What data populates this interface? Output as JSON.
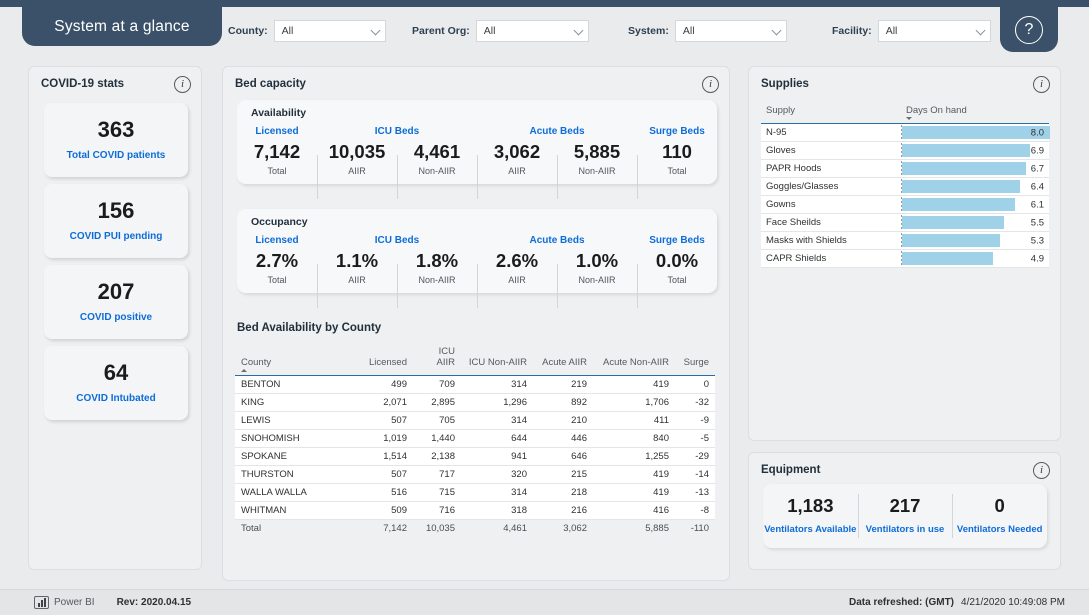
{
  "header": {
    "title": "System at a glance",
    "help_icon": "question-mark-icon",
    "filters": [
      {
        "label": "County:",
        "value": "All"
      },
      {
        "label": "Parent Org:",
        "value": "All"
      },
      {
        "label": "System:",
        "value": "All"
      },
      {
        "label": "Facility:",
        "value": "All"
      }
    ]
  },
  "covid": {
    "title": "COVID-19 stats",
    "cards": [
      {
        "value": "363",
        "label": "Total COVID patients"
      },
      {
        "value": "156",
        "label": "COVID PUI pending"
      },
      {
        "value": "207",
        "label": "COVID positive"
      },
      {
        "value": "64",
        "label": "COVID Intubated"
      }
    ]
  },
  "bed": {
    "title": "Bed capacity",
    "availability": {
      "title": "Availability",
      "groups": [
        {
          "label": "Licensed",
          "span": 1
        },
        {
          "label": "ICU Beds",
          "span": 2
        },
        {
          "label": "Acute Beds",
          "span": 2
        },
        {
          "label": "Surge Beds",
          "span": 1
        }
      ],
      "metrics": [
        {
          "value": "7,142",
          "sub": "Total"
        },
        {
          "value": "10,035",
          "sub": "AIIR"
        },
        {
          "value": "4,461",
          "sub": "Non-AIIR"
        },
        {
          "value": "3,062",
          "sub": "AIIR"
        },
        {
          "value": "5,885",
          "sub": "Non-AIIR"
        },
        {
          "value": "110",
          "sub": "Total"
        }
      ]
    },
    "occupancy": {
      "title": "Occupancy",
      "groups": [
        {
          "label": "Licensed",
          "span": 1
        },
        {
          "label": "ICU Beds",
          "span": 2
        },
        {
          "label": "Acute Beds",
          "span": 2
        },
        {
          "label": "Surge Beds",
          "span": 1
        }
      ],
      "metrics": [
        {
          "value": "2.7%",
          "sub": "Total"
        },
        {
          "value": "1.1%",
          "sub": "AIIR"
        },
        {
          "value": "1.8%",
          "sub": "Non-AIIR"
        },
        {
          "value": "2.6%",
          "sub": "AIIR"
        },
        {
          "value": "1.0%",
          "sub": "Non-AIIR"
        },
        {
          "value": "0.0%",
          "sub": "Total"
        }
      ]
    },
    "table": {
      "title": "Bed Availability by County",
      "columns": [
        "County",
        "Licensed",
        "ICU AIIR",
        "ICU Non-AIIR",
        "Acute AIIR",
        "Acute Non-AIIR",
        "Surge"
      ],
      "sort_column": "County",
      "sort_direction": "asc",
      "rows": [
        [
          "BENTON",
          "499",
          "709",
          "314",
          "219",
          "419",
          "0"
        ],
        [
          "KING",
          "2,071",
          "2,895",
          "1,296",
          "892",
          "1,706",
          "-32"
        ],
        [
          "LEWIS",
          "507",
          "705",
          "314",
          "210",
          "411",
          "-9"
        ],
        [
          "SNOHOMISH",
          "1,019",
          "1,440",
          "644",
          "446",
          "840",
          "-5"
        ],
        [
          "SPOKANE",
          "1,514",
          "2,138",
          "941",
          "646",
          "1,255",
          "-29"
        ],
        [
          "THURSTON",
          "507",
          "717",
          "320",
          "215",
          "419",
          "-14"
        ],
        [
          "WALLA WALLA",
          "516",
          "715",
          "314",
          "218",
          "419",
          "-13"
        ],
        [
          "WHITMAN",
          "509",
          "716",
          "318",
          "216",
          "416",
          "-8"
        ]
      ],
      "total_row": [
        "Total",
        "7,142",
        "10,035",
        "4,461",
        "3,062",
        "5,885",
        "-110"
      ]
    }
  },
  "supplies": {
    "title": "Supplies",
    "columns": [
      "Supply",
      "Days On hand"
    ],
    "sort_column": "Days On hand",
    "sort_direction": "desc",
    "bar_color": "#9fd2e8",
    "max_value": 8.0,
    "rows": [
      {
        "name": "N-95",
        "value": "8.0",
        "num": 8.0
      },
      {
        "name": "Gloves",
        "value": "6.9",
        "num": 6.9
      },
      {
        "name": "PAPR Hoods",
        "value": "6.7",
        "num": 6.7
      },
      {
        "name": "Goggles/Glasses",
        "value": "6.4",
        "num": 6.4
      },
      {
        "name": "Gowns",
        "value": "6.1",
        "num": 6.1
      },
      {
        "name": "Face Sheilds",
        "value": "5.5",
        "num": 5.5
      },
      {
        "name": "Masks with Shields",
        "value": "5.3",
        "num": 5.3
      },
      {
        "name": "CAPR Shields",
        "value": "4.9",
        "num": 4.9
      }
    ]
  },
  "equipment": {
    "title": "Equipment",
    "cells": [
      {
        "value": "1,183",
        "label": "Ventilators Available"
      },
      {
        "value": "217",
        "label": "Ventilators in use"
      },
      {
        "value": "0",
        "label": "Ventilators Needed"
      }
    ]
  },
  "footer": {
    "powerbi_label": "Power BI",
    "revision": "Rev: 2020.04.15",
    "refresh_label": "Data refreshed: (GMT)",
    "refresh_time": "4/21/2020 10:49:08 PM"
  },
  "chart_data": {
    "type": "bar",
    "title": "Supplies — Days On hand",
    "orientation": "horizontal",
    "categories": [
      "N-95",
      "Gloves",
      "PAPR Hoods",
      "Goggles/Glasses",
      "Gowns",
      "Face Sheilds",
      "Masks with Shields",
      "CAPR Shields"
    ],
    "values": [
      8.0,
      6.9,
      6.7,
      6.4,
      6.1,
      5.5,
      5.3,
      4.9
    ],
    "xlabel": "Days On hand",
    "ylabel": "Supply",
    "xlim": [
      0,
      8.0
    ],
    "grid": false,
    "legend": "none"
  }
}
